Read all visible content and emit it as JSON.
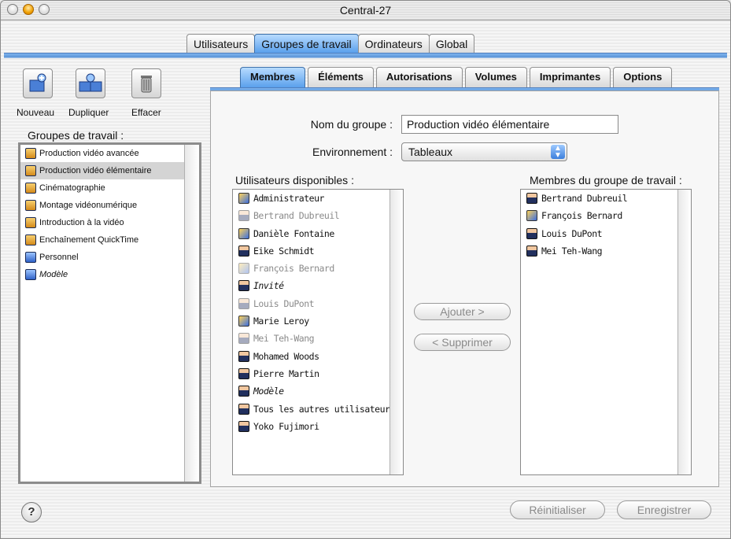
{
  "window": {
    "title": "Central-27"
  },
  "top_tabs": [
    {
      "label": "Utilisateurs",
      "active": false
    },
    {
      "label": "Groupes de travail",
      "active": true
    },
    {
      "label": "Ordinateurs",
      "active": false
    },
    {
      "label": "Global",
      "active": false
    }
  ],
  "toolbar": {
    "new_label": "Nouveau",
    "duplicate_label": "Dupliquer",
    "delete_label": "Effacer"
  },
  "left_panel": {
    "title": "Groupes de travail :",
    "groups": [
      {
        "label": "Production vidéo avancée",
        "icon": "workgroup-icon",
        "selected": false
      },
      {
        "label": "Production vidéo élémentaire",
        "icon": "workgroup-icon",
        "selected": true
      },
      {
        "label": "Cinématographie",
        "icon": "workgroup-icon",
        "selected": false
      },
      {
        "label": "Montage vidéonumérique",
        "icon": "workgroup-icon",
        "selected": false
      },
      {
        "label": "Introduction à la vidéo",
        "icon": "workgroup-icon",
        "selected": false
      },
      {
        "label": "Enchaînement QuickTime",
        "icon": "workgroup-icon",
        "selected": false
      },
      {
        "label": "Personnel",
        "icon": "workgroup-icon",
        "selected": false
      },
      {
        "label": "Modèle",
        "icon": "workgroup-icon",
        "selected": false
      }
    ]
  },
  "sub_tabs": [
    {
      "label": "Membres",
      "active": true
    },
    {
      "label": "Éléments",
      "active": false
    },
    {
      "label": "Autorisations",
      "active": false
    },
    {
      "label": "Volumes",
      "active": false
    },
    {
      "label": "Imprimantes",
      "active": false
    },
    {
      "label": "Options",
      "active": false
    }
  ],
  "form": {
    "group_name_label": "Nom du groupe :",
    "group_name_value": "Production vidéo élémentaire",
    "environment_label": "Environnement :",
    "environment_value": "Tableaux"
  },
  "available_users": {
    "title": "Utilisateurs disponibles :",
    "items": [
      {
        "label": "Administrateur",
        "icon": "admin-icon",
        "dimmed": false
      },
      {
        "label": "Bertrand Dubreuil",
        "icon": "user-icon",
        "dimmed": true
      },
      {
        "label": "Danièle Fontaine",
        "icon": "admin-icon",
        "dimmed": false
      },
      {
        "label": "Eike Schmidt",
        "icon": "user-icon",
        "dimmed": false
      },
      {
        "label": "François Bernard",
        "icon": "admin-icon",
        "dimmed": true
      },
      {
        "label": "Invité",
        "icon": "user-icon",
        "dimmed": false
      },
      {
        "label": "Louis DuPont",
        "icon": "user-icon",
        "dimmed": true
      },
      {
        "label": "Marie Leroy",
        "icon": "admin-icon",
        "dimmed": false
      },
      {
        "label": "Mei Teh-Wang",
        "icon": "user-icon",
        "dimmed": true
      },
      {
        "label": "Mohamed Woods",
        "icon": "user-icon",
        "dimmed": false
      },
      {
        "label": "Pierre Martin",
        "icon": "user-icon",
        "dimmed": false
      },
      {
        "label": "Modèle",
        "icon": "user-icon",
        "dimmed": false
      },
      {
        "label": "Tous les autres utilisateurs",
        "icon": "user-icon",
        "dimmed": false
      },
      {
        "label": "Yoko Fujimori",
        "icon": "user-icon",
        "dimmed": false
      }
    ]
  },
  "members": {
    "title": "Membres du groupe de travail :",
    "items": [
      {
        "label": "Bertrand Dubreuil",
        "icon": "user-icon"
      },
      {
        "label": "François Bernard",
        "icon": "admin-icon"
      },
      {
        "label": "Louis DuPont",
        "icon": "user-icon"
      },
      {
        "label": "Mei Teh-Wang",
        "icon": "user-icon"
      }
    ]
  },
  "actions": {
    "add_label": "Ajouter >",
    "remove_label": "< Supprimer"
  },
  "footer": {
    "help_label": "?",
    "reset_label": "Réinitialiser",
    "save_label": "Enregistrer"
  }
}
